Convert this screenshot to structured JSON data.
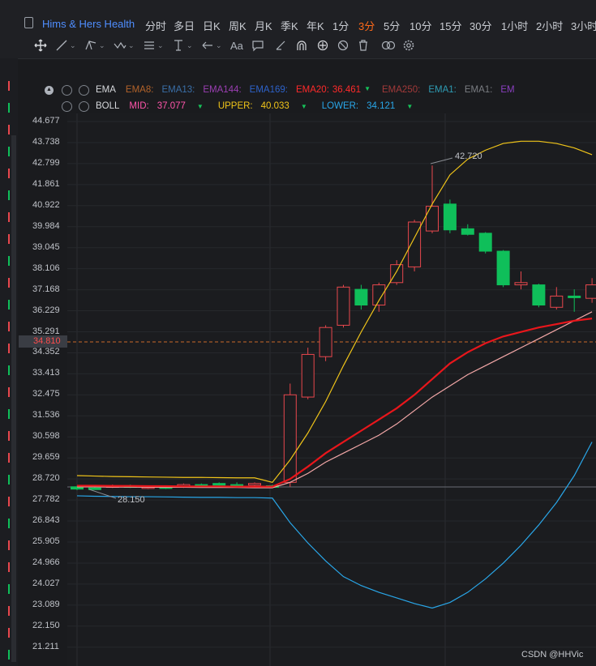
{
  "header": {
    "title": "Hims & Hers Health",
    "periods": [
      "分时",
      "多日",
      "日K",
      "周K",
      "月K",
      "季K",
      "年K",
      "1分",
      "3分",
      "5分",
      "10分",
      "15分",
      "30分",
      "1小时",
      "2小时",
      "3小时"
    ],
    "active_period": "3分"
  },
  "tools": [
    "move-icon",
    "line-icon",
    "channel-icon",
    "pattern-icon",
    "fib-icon",
    "measure-icon",
    "arrow-icon",
    "text-icon",
    "note-icon",
    "ruler-icon",
    "magnet-icon",
    "sync-icon",
    "hide-icon",
    "delete-icon",
    "visibility-icon",
    "settings-icon"
  ],
  "text_tool_label": "Aa",
  "ema": {
    "name": "EMA",
    "items": [
      {
        "label": "EMA8:",
        "value": "",
        "color": "#b3632a"
      },
      {
        "label": "EMA13:",
        "value": "",
        "color": "#3a6fa8"
      },
      {
        "label": "EMA144:",
        "value": "",
        "color": "#9b3fb3"
      },
      {
        "label": "EMA169:",
        "value": "",
        "color": "#2d62c9"
      },
      {
        "label": "EMA20:",
        "value": "36.461",
        "color": "#ff2a2a"
      },
      {
        "label": "EMA250:",
        "value": "",
        "color": "#a33a3a"
      },
      {
        "label": "EMA1:",
        "value": "",
        "color": "#2e9bb3"
      },
      {
        "label": "EMA1:",
        "value": "",
        "color": "#7a7d82"
      },
      {
        "label": "EM",
        "value": "",
        "color": "#8a3fc0"
      }
    ]
  },
  "boll": {
    "name": "BOLL",
    "mid_label": "MID:",
    "mid": "37.077",
    "mid_color": "#ff55aa",
    "upper_label": "UPPER:",
    "upper": "40.033",
    "upper_color": "#f0c419",
    "lower_label": "LOWER:",
    "lower": "34.121",
    "lower_color": "#29a6e8"
  },
  "price_axis": [
    "44.677",
    "43.738",
    "42.799",
    "41.861",
    "40.922",
    "39.984",
    "39.045",
    "38.106",
    "37.168",
    "36.229",
    "35.291",
    "34.352",
    "33.413",
    "32.475",
    "31.536",
    "30.598",
    "29.659",
    "28.720",
    "27.782",
    "26.843",
    "25.905",
    "24.966",
    "24.027",
    "23.089",
    "22.150",
    "21.211"
  ],
  "current_price": "34.810",
  "annotations": {
    "high": "42.720",
    "low": "28.150"
  },
  "watermark": "CSDN @HHVic",
  "chart_data": {
    "type": "candlestick",
    "y_axis_range": [
      21.211,
      44.677
    ],
    "candles": [
      {
        "o": 28.4,
        "c": 28.3,
        "h": 28.45,
        "l": 28.25
      },
      {
        "o": 28.35,
        "c": 28.3,
        "h": 28.42,
        "l": 28.28
      },
      {
        "o": 28.4,
        "c": 28.45,
        "h": 28.5,
        "l": 28.35
      },
      {
        "o": 28.45,
        "c": 28.4,
        "h": 28.5,
        "l": 28.35
      },
      {
        "o": 28.35,
        "c": 28.4,
        "h": 28.45,
        "l": 28.3
      },
      {
        "o": 28.4,
        "c": 28.35,
        "h": 28.45,
        "l": 28.3
      },
      {
        "o": 28.4,
        "c": 28.5,
        "h": 28.55,
        "l": 28.35
      },
      {
        "o": 28.5,
        "c": 28.45,
        "h": 28.55,
        "l": 28.4
      },
      {
        "o": 28.55,
        "c": 28.5,
        "h": 28.6,
        "l": 28.45
      },
      {
        "o": 28.5,
        "c": 28.45,
        "h": 28.6,
        "l": 28.4
      },
      {
        "o": 28.5,
        "c": 28.55,
        "h": 28.6,
        "l": 28.45
      },
      {
        "o": 28.45,
        "c": 28.4,
        "h": 28.5,
        "l": 28.35
      },
      {
        "o": 28.6,
        "c": 32.5,
        "h": 33.0,
        "l": 28.4
      },
      {
        "o": 32.4,
        "c": 34.3,
        "h": 34.6,
        "l": 32.3
      },
      {
        "o": 34.2,
        "c": 35.5,
        "h": 35.6,
        "l": 34.0
      },
      {
        "o": 35.6,
        "c": 37.3,
        "h": 37.4,
        "l": 35.5
      },
      {
        "o": 37.2,
        "c": 36.5,
        "h": 37.4,
        "l": 36.3
      },
      {
        "o": 36.5,
        "c": 37.4,
        "h": 37.5,
        "l": 36.2
      },
      {
        "o": 37.5,
        "c": 38.3,
        "h": 38.5,
        "l": 37.4
      },
      {
        "o": 38.2,
        "c": 40.2,
        "h": 40.3,
        "l": 38.0
      },
      {
        "o": 39.8,
        "c": 40.9,
        "h": 42.72,
        "l": 39.7
      },
      {
        "o": 41.0,
        "c": 39.85,
        "h": 41.2,
        "l": 39.7
      },
      {
        "o": 39.9,
        "c": 39.65,
        "h": 40.1,
        "l": 39.6
      },
      {
        "o": 39.7,
        "c": 38.9,
        "h": 39.75,
        "l": 38.8
      },
      {
        "o": 38.9,
        "c": 37.4,
        "h": 38.95,
        "l": 37.3
      },
      {
        "o": 37.4,
        "c": 37.5,
        "h": 38.0,
        "l": 37.2
      },
      {
        "o": 37.4,
        "c": 36.5,
        "h": 37.45,
        "l": 36.4
      },
      {
        "o": 36.4,
        "c": 36.9,
        "h": 37.3,
        "l": 36.3
      },
      {
        "o": 36.9,
        "c": 36.85,
        "h": 37.2,
        "l": 36.2
      },
      {
        "o": 36.8,
        "c": 37.4,
        "h": 37.7,
        "l": 36.6
      }
    ],
    "series": [
      {
        "name": "UPPER",
        "color": "#f0c419",
        "values": [
          28.9,
          28.88,
          28.86,
          28.85,
          28.84,
          28.83,
          28.82,
          28.82,
          28.81,
          28.8,
          28.8,
          28.6,
          29.6,
          30.8,
          32.2,
          33.8,
          35.3,
          36.7,
          38.0,
          39.5,
          41.0,
          42.3,
          43.0,
          43.4,
          43.7,
          43.8,
          43.8,
          43.7,
          43.5,
          43.2
        ]
      },
      {
        "name": "MID",
        "color": "#f3a7a7",
        "values": [
          28.4,
          28.4,
          28.39,
          28.39,
          28.38,
          28.38,
          28.38,
          28.37,
          28.37,
          28.37,
          28.36,
          28.36,
          28.6,
          29.0,
          29.5,
          29.9,
          30.3,
          30.7,
          31.2,
          31.8,
          32.4,
          32.9,
          33.4,
          33.8,
          34.2,
          34.6,
          35.0,
          35.4,
          35.8,
          36.2
        ]
      },
      {
        "name": "LOWER",
        "color": "#29a6e8",
        "values": [
          28.0,
          27.98,
          27.97,
          27.96,
          27.96,
          27.95,
          27.94,
          27.93,
          27.93,
          27.92,
          27.92,
          27.9,
          26.8,
          25.9,
          25.1,
          24.4,
          24.0,
          23.7,
          23.45,
          23.2,
          23.0,
          23.25,
          23.7,
          24.3,
          25.0,
          25.8,
          26.7,
          27.7,
          28.9,
          30.4
        ]
      },
      {
        "name": "EMA20",
        "color": "#e8161b",
        "values": [
          28.45,
          28.45,
          28.44,
          28.44,
          28.43,
          28.43,
          28.42,
          28.42,
          28.42,
          28.41,
          28.41,
          28.41,
          28.75,
          29.3,
          29.9,
          30.4,
          30.9,
          31.4,
          31.9,
          32.5,
          33.2,
          33.9,
          34.4,
          34.8,
          35.1,
          35.3,
          35.5,
          35.65,
          35.8,
          35.9
        ]
      }
    ]
  }
}
